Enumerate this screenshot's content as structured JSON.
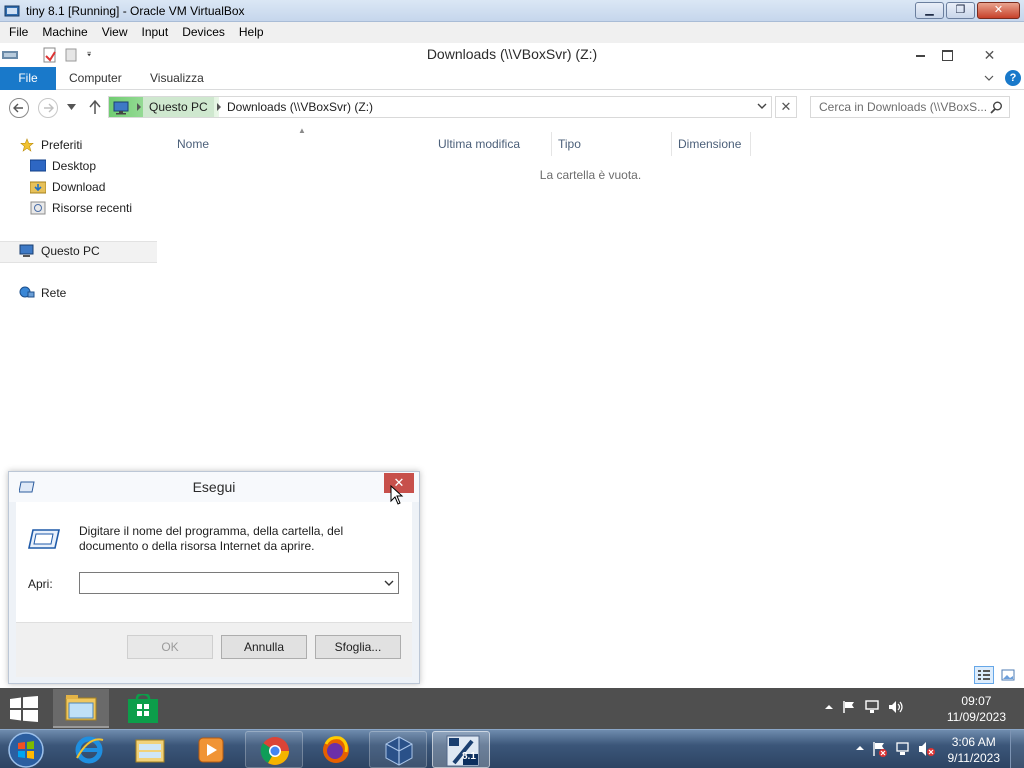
{
  "host_window": {
    "title": "tiny 8.1 [Running] - Oracle VM VirtualBox",
    "menu": [
      "File",
      "Machine",
      "View",
      "Input",
      "Devices",
      "Help"
    ]
  },
  "explorer": {
    "window_title": "Downloads (\\\\VBoxSvr) (Z:)",
    "ribbon": {
      "file_tab": "File",
      "tabs": [
        "Computer",
        "Visualizza"
      ]
    },
    "address": {
      "crumbs": [
        "Questo PC",
        "Downloads (\\\\VBoxSvr) (Z:)"
      ]
    },
    "search": {
      "placeholder": "Cerca in Downloads (\\\\VBoxS..."
    },
    "nav_pane": {
      "favorites_label": "Preferiti",
      "favorites": [
        "Desktop",
        "Download",
        "Risorse recenti"
      ],
      "this_pc": "Questo PC",
      "network": "Rete"
    },
    "columns": [
      "Nome",
      "Ultima modifica",
      "Tipo",
      "Dimensione"
    ],
    "empty_message": "La cartella è vuota."
  },
  "run_dialog": {
    "title": "Esegui",
    "description": "Digitare il nome del programma, della cartella, del documento o della risorsa Internet da aprire.",
    "open_label": "Apri:",
    "open_value": "",
    "buttons": {
      "ok": "OK",
      "cancel": "Annulla",
      "browse": "Sfoglia..."
    }
  },
  "guest_taskbar": {
    "apps": [
      "start-icon",
      "file-explorer-icon",
      "store-icon"
    ],
    "clock": {
      "time": "09:07",
      "date": "11/09/2023"
    }
  },
  "host_taskbar": {
    "apps": [
      "internet-explorer-icon",
      "windows-explorer-icon",
      "media-player-icon",
      "chrome-icon",
      "firefox-icon",
      "virtualbox-icon",
      "vm-8.1-icon"
    ],
    "vm_badge": "8.1",
    "clock": {
      "time": "3:06 AM",
      "date": "9/11/2023"
    }
  },
  "colors": {
    "accent_blue": "#1979ca",
    "close_red": "#c7504b",
    "guest_taskbar": "#4f4f4f"
  }
}
